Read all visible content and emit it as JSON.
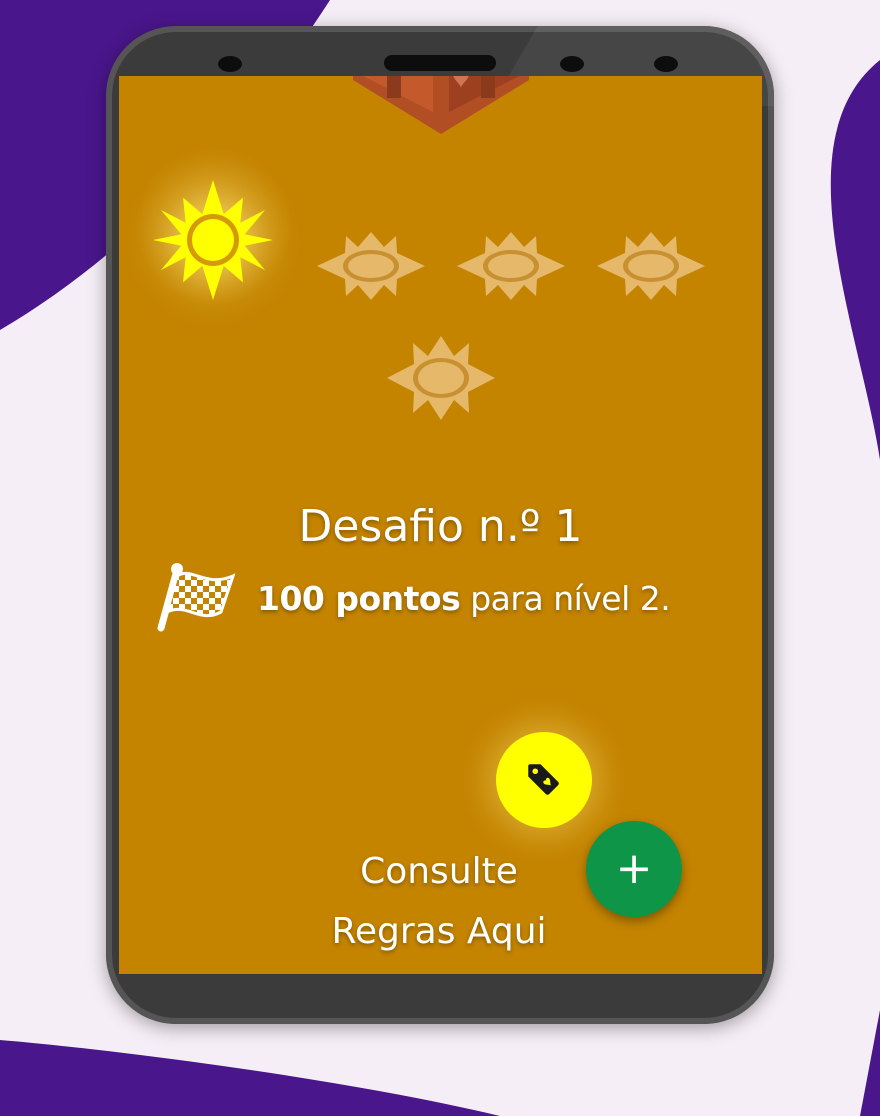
{
  "challenge": {
    "title": "Desafio n.º 1",
    "goal_points": "100 pontos",
    "goal_suffix": " para nível 2."
  },
  "rules_link": {
    "line1": "Consulte",
    "line2": "Regras Aqui"
  },
  "fab_add": {
    "label": "+"
  },
  "progress": {
    "suns_total": 5,
    "suns_earned": 1
  },
  "icons": {
    "chest": "treasure-chest-icon",
    "sun": "sun-icon",
    "flag": "checkered-flag-icon",
    "tag": "heart-tag-icon",
    "add": "plus-icon"
  },
  "colors": {
    "background": "#4a168c",
    "screen": "#c48400",
    "sun_active": "#ffff00",
    "sun_inactive": "#e5b86a",
    "tag_button": "#ffff00",
    "add_button": "#0e9547"
  }
}
